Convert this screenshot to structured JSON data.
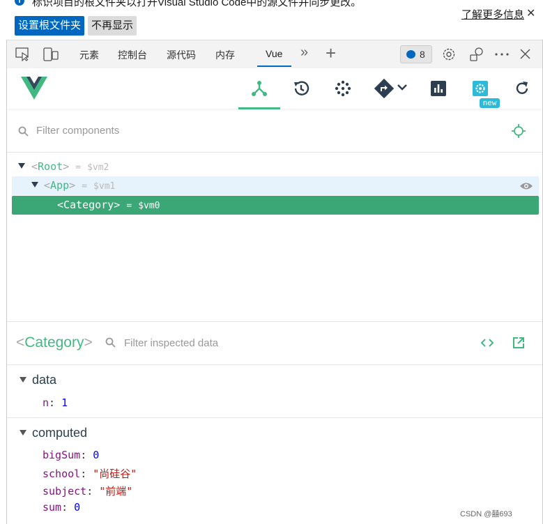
{
  "infobar": {
    "info_icon": "i",
    "message": "标识项目的根文件夹以打开Visual Studio Code中的源文件并同步更改。",
    "learn_more": "了解更多信息",
    "close": "✕",
    "set_root_button": "设置根文件夹",
    "dont_show_button": "不再显示"
  },
  "devtools_tabs": {
    "items": [
      "元素",
      "控制台",
      "源代码",
      "内存",
      "Vue"
    ],
    "active": "Vue",
    "more": "»",
    "add": "+",
    "issues_count": "8"
  },
  "vue_toolbar": {
    "new_badge": "new"
  },
  "component_filter": {
    "placeholder": "Filter components"
  },
  "tree": [
    {
      "open": "<",
      "name": "Root",
      "close": ">",
      "eq": "=",
      "var": "$vm2"
    },
    {
      "open": "<",
      "name": "App",
      "close": ">",
      "eq": "=",
      "var": "$vm1"
    },
    {
      "open": "<",
      "name": "Category",
      "close": ">",
      "eq": "=",
      "var": "$vm0"
    }
  ],
  "inspector": {
    "open": "<",
    "name": "Category",
    "close": ">",
    "filter_placeholder": "Filter inspected data",
    "sections": [
      {
        "title": "data",
        "props": [
          {
            "key": "n",
            "value": "1"
          }
        ]
      },
      {
        "title": "computed",
        "props": [
          {
            "key": "bigSum",
            "value": "0"
          },
          {
            "key": "school",
            "value": "\"尚硅谷\""
          },
          {
            "key": "subject",
            "value": "\"前端\""
          },
          {
            "key": "sum",
            "value": "0"
          }
        ]
      }
    ]
  },
  "watermark": "CSDN @囍693",
  "colors": {
    "vue_green": "#42b983",
    "selected_row": "#3ba776",
    "hover_row": "#e6f2fc",
    "edge_blue": "#0067c0"
  }
}
